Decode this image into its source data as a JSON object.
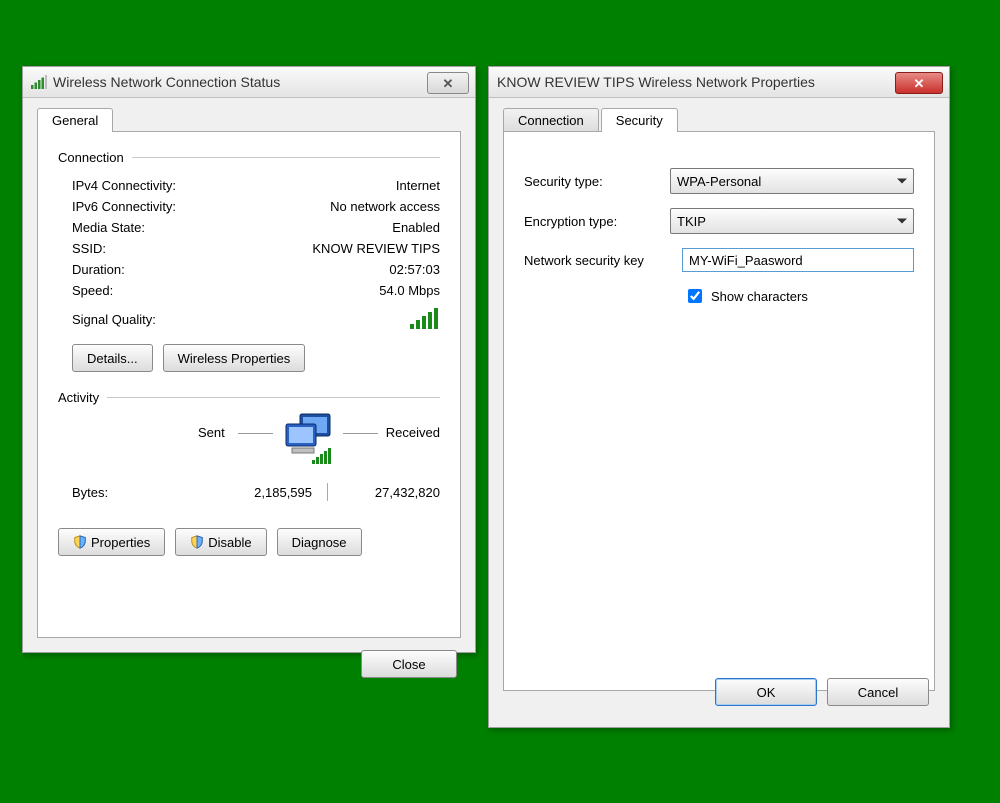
{
  "status_dialog": {
    "title": "Wireless Network Connection Status",
    "tabs": {
      "general": "General"
    },
    "connection": {
      "group_label": "Connection",
      "ipv4_label": "IPv4 Connectivity:",
      "ipv4_value": "Internet",
      "ipv6_label": "IPv6 Connectivity:",
      "ipv6_value": "No network access",
      "media_label": "Media State:",
      "media_value": "Enabled",
      "ssid_label": "SSID:",
      "ssid_value": "KNOW REVIEW TIPS",
      "duration_label": "Duration:",
      "duration_value": "02:57:03",
      "speed_label": "Speed:",
      "speed_value": "54.0 Mbps",
      "signal_label": "Signal Quality:"
    },
    "buttons": {
      "details": "Details...",
      "wireless_props": "Wireless Properties"
    },
    "activity": {
      "group_label": "Activity",
      "sent_label": "Sent",
      "received_label": "Received",
      "bytes_label": "Bytes:",
      "bytes_sent": "2,185,595",
      "bytes_received": "27,432,820"
    },
    "footer_buttons": {
      "properties": "Properties",
      "disable": "Disable",
      "diagnose": "Diagnose"
    },
    "close": "Close"
  },
  "props_dialog": {
    "title": "KNOW REVIEW TIPS Wireless Network Properties",
    "tabs": {
      "connection": "Connection",
      "security": "Security"
    },
    "security": {
      "sectype_label": "Security type:",
      "sectype_value": "WPA-Personal",
      "enctype_label": "Encryption type:",
      "enctype_value": "TKIP",
      "key_label": "Network security key",
      "key_value": "MY-WiFi_Paasword",
      "show_label": "Show characters",
      "show_checked": true
    },
    "ok": "OK",
    "cancel": "Cancel"
  }
}
